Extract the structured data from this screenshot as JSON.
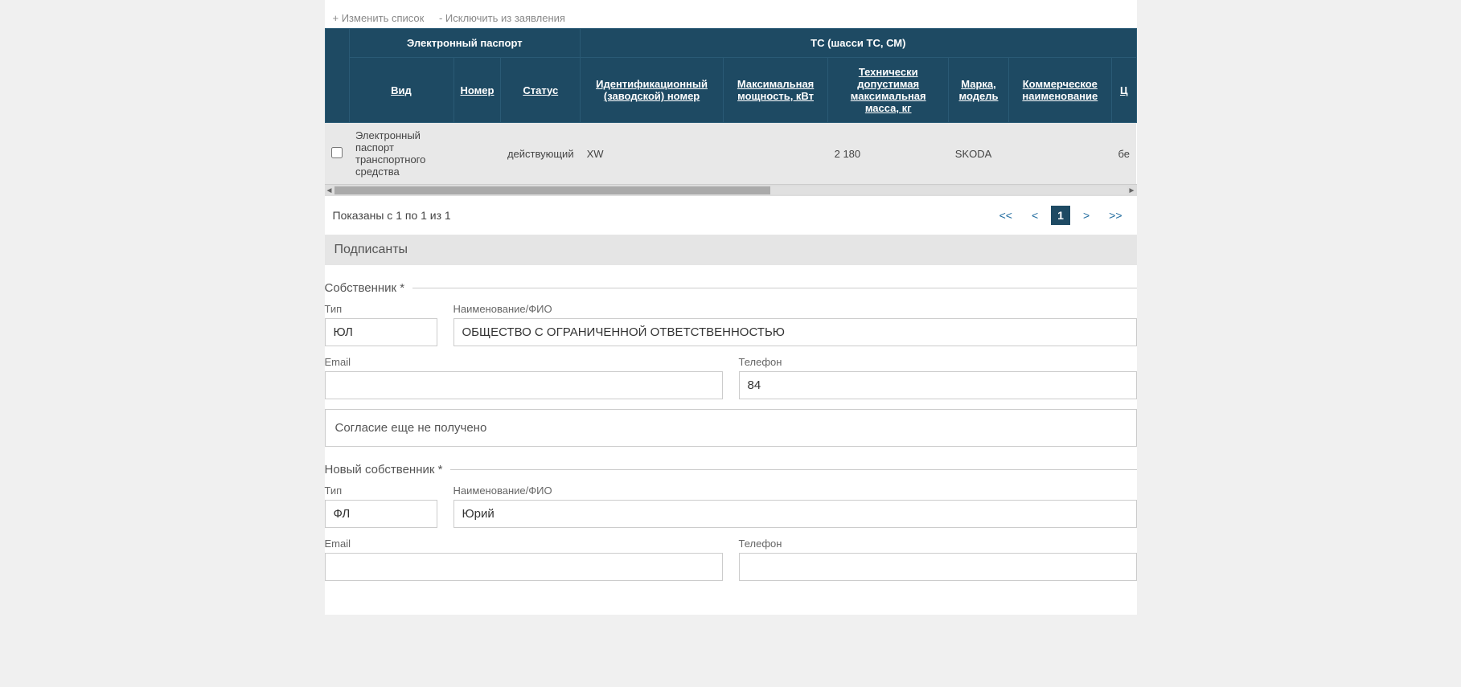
{
  "actions": {
    "change_list": "+ Изменить список",
    "exclude": "- Исключить из заявления"
  },
  "table": {
    "group_headers": {
      "passport": "Электронный паспорт",
      "vehicle": "ТС (шасси ТС, СМ)"
    },
    "headers": {
      "type": "Вид",
      "number": "Номер",
      "status": "Статус",
      "id_number": "Идентификационный (заводской) номер",
      "max_power": "Максимальная мощность, кВт",
      "max_mass": "Технически допустимая максимальная масса, кг",
      "brand": "Марка, модель",
      "commercial_name": "Коммерческое наименование",
      "extra": "Ц"
    },
    "rows": [
      {
        "type": "Электронный паспорт транспортного средства",
        "number": "",
        "status": "действующий",
        "id_number": "XW",
        "max_power": "",
        "max_mass": "2 180",
        "brand": "SKODA",
        "commercial_name": "",
        "extra": "бе"
      }
    ]
  },
  "pagination": {
    "info": "Показаны с 1 по 1 из 1",
    "first": "<<",
    "prev": "<",
    "current": "1",
    "next": ">",
    "last": ">>"
  },
  "sections": {
    "signers": "Подписанты",
    "owner": "Собственник *",
    "new_owner": "Новый собственник *"
  },
  "owner": {
    "type_label": "Тип",
    "type_value": "ЮЛ",
    "name_label": "Наименование/ФИО",
    "name_value": "ОБЩЕСТВО С ОГРАНИЧЕННОЙ ОТВЕТСТВЕННОСТЬЮ",
    "email_label": "Email",
    "email_value": "",
    "phone_label": "Телефон",
    "phone_value": "84",
    "consent": "Согласие еще не получено"
  },
  "new_owner": {
    "type_label": "Тип",
    "type_value": "ФЛ",
    "name_label": "Наименование/ФИО",
    "name_value": "Юрий",
    "email_label": "Email",
    "email_value": "",
    "phone_label": "Телефон",
    "phone_value": ""
  }
}
